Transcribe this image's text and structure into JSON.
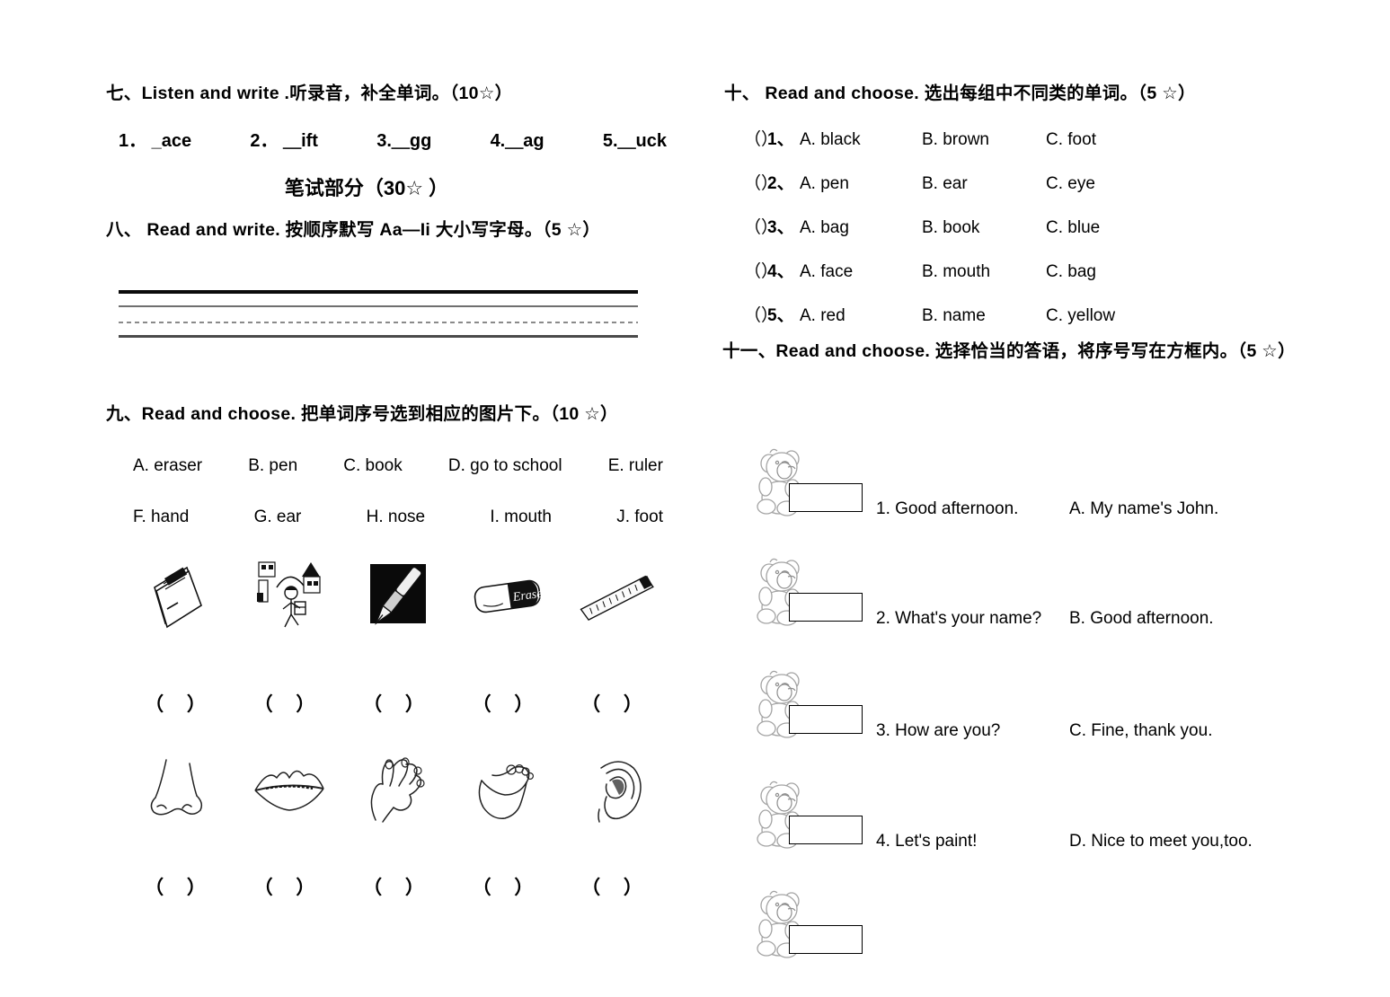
{
  "sections": {
    "listen_write": {
      "heading": "七、Listen and write .听录音，补全单词。（10☆）",
      "items": [
        "1． _ace",
        "2． ＿ift",
        "3.＿gg",
        "4.＿ag",
        "5.＿uck"
      ]
    },
    "written_part_title": "笔试部分（30☆ ）",
    "read_write": {
      "heading": "八、 Read and write. 按顺序默写 Aa—Ii 大小写字母。（5 ☆）"
    },
    "read_choose_pictures": {
      "heading": "九、Read and choose. 把单词序号选到相应的图片下。（10 ☆）",
      "word_bank_row1": [
        "A. eraser",
        "B. pen",
        "C. book",
        "D. go to school",
        "E. ruler"
      ],
      "word_bank_row2": [
        "F. hand",
        "G. ear",
        "H. nose",
        "I. mouth",
        "J. foot"
      ],
      "picture_row1": [
        "book-picture",
        "go-to-school-picture",
        "pen-picture",
        "eraser-picture",
        "ruler-picture"
      ],
      "picture_row2": [
        "nose-picture",
        "mouth-picture",
        "hand-picture",
        "foot-picture",
        "ear-picture"
      ],
      "answer_blank": "（  ）"
    },
    "odd_one_out": {
      "heading": "十、 Read and choose. 选出每组中不同类的单词。（5 ☆）",
      "items": [
        {
          "paren": "（）",
          "num": "1、",
          "a": "A. black",
          "b": "B. brown",
          "c": "C. foot"
        },
        {
          "paren": "（）",
          "num": "2、",
          "a": "A. pen",
          "b": "B. ear",
          "c": "C. eye"
        },
        {
          "paren": "（）",
          "num": "3、",
          "a": "A. bag",
          "b": "B. book",
          "c": " C. blue"
        },
        {
          "paren": "（）",
          "num": "4、",
          "a": "A. face",
          "b": " B. mouth",
          "c": " C. bag"
        },
        {
          "paren": "（）",
          "num": "5、",
          "a": "A. red",
          "b": "B. name",
          "c": "C. yellow"
        }
      ]
    },
    "matching": {
      "heading": "十一、Read and choose. 选择恰当的答语，将序号写在方框内。（5 ☆）",
      "rows": [
        {
          "question": "1. Good afternoon.",
          "answer": "A.  My name's John."
        },
        {
          "question": "2. What's your name?",
          "answer": "B. Good afternoon."
        },
        {
          "question": "3. How are you?",
          "answer": "C.  Fine, thank you."
        },
        {
          "question": "4. Let's paint!",
          "answer": "D. Nice to meet you,too."
        },
        {
          "question": "",
          "answer": ""
        }
      ]
    }
  },
  "colors": {
    "ink": "#000000",
    "paper": "#ffffff",
    "bear_line": "#9a9a9a",
    "sketch_line": "#1a1a1a"
  }
}
